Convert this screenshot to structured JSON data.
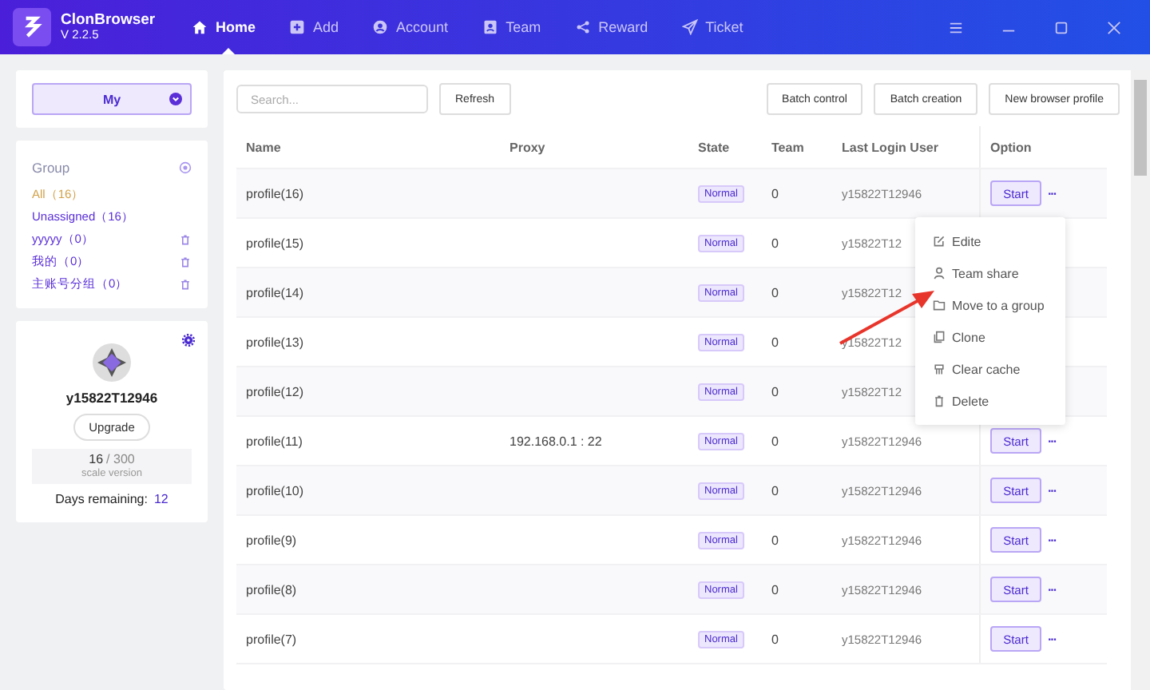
{
  "app": {
    "name": "ClonBrowser",
    "version": "V 2.2.5"
  },
  "nav": [
    {
      "label": "Home",
      "selected": true
    },
    {
      "label": "Add",
      "selected": false
    },
    {
      "label": "Account",
      "selected": false
    },
    {
      "label": "Team",
      "selected": false
    },
    {
      "label": "Reward",
      "selected": false
    },
    {
      "label": "Ticket",
      "selected": false
    }
  ],
  "scope_select": {
    "value": "My"
  },
  "groups": {
    "title": "Group",
    "items": [
      {
        "label": "All（16）",
        "selected": true,
        "deletable": false
      },
      {
        "label": "Unassigned（16）",
        "selected": false,
        "deletable": false
      },
      {
        "label": "yyyyy（0）",
        "selected": false,
        "deletable": true
      },
      {
        "label": "我的（0）",
        "selected": false,
        "deletable": true
      },
      {
        "label": "主账号分组（0）",
        "selected": false,
        "deletable": true
      }
    ]
  },
  "user": {
    "name": "y15822T12946",
    "upgrade": "Upgrade",
    "used": "16",
    "total": "/ 300",
    "plan": "scale version",
    "days_label": "Days remaining:",
    "days": "12"
  },
  "toolbar": {
    "search_placeholder": "Search...",
    "refresh": "Refresh",
    "buttons": [
      "Batch control",
      "Batch creation",
      "New browser profile"
    ]
  },
  "table": {
    "columns": [
      "Name",
      "Proxy",
      "State",
      "Team",
      "Last Login User",
      "Option"
    ],
    "rows": [
      {
        "name": "profile(16)",
        "state": "Normal",
        "team": "0",
        "user": "y15822T12946",
        "action": "Start",
        "menu": "···"
      },
      {
        "name": "profile(15)",
        "state": "Normal",
        "team": "0",
        "user": "y15822T12"
      },
      {
        "name": "profile(14)",
        "state": "Normal",
        "team": "0",
        "user": "y15822T12"
      },
      {
        "name": "profile(13)",
        "state": "Normal",
        "team": "0",
        "user": "y15822T12"
      },
      {
        "name": "profile(12)",
        "state": "Normal",
        "team": "0",
        "user": "y15822T12"
      },
      {
        "name": "profile(11)",
        "proxy": "192.168.0.1 : 22",
        "state": "Normal",
        "team": "0",
        "user": "y15822T12946",
        "action": "Start",
        "menu": "···"
      },
      {
        "name": "profile(10)",
        "state": "Normal",
        "team": "0",
        "user": "y15822T12946",
        "action": "Start",
        "menu": "···"
      },
      {
        "name": "profile(9)",
        "state": "Normal",
        "team": "0",
        "user": "y15822T12946",
        "action": "Start",
        "menu": "···"
      },
      {
        "name": "profile(8)",
        "state": "Normal",
        "team": "0",
        "user": "y15822T12946",
        "action": "Start",
        "menu": "···"
      },
      {
        "name": "profile(7)",
        "state": "Normal",
        "team": "0",
        "user": "y15822T12946",
        "action": "Start",
        "menu": "···"
      }
    ]
  },
  "context_menu": [
    {
      "label": "Edite"
    },
    {
      "label": "Team share"
    },
    {
      "label": "Move to a group"
    },
    {
      "label": "Clone"
    },
    {
      "label": "Clear cache"
    },
    {
      "label": "Delete"
    }
  ]
}
